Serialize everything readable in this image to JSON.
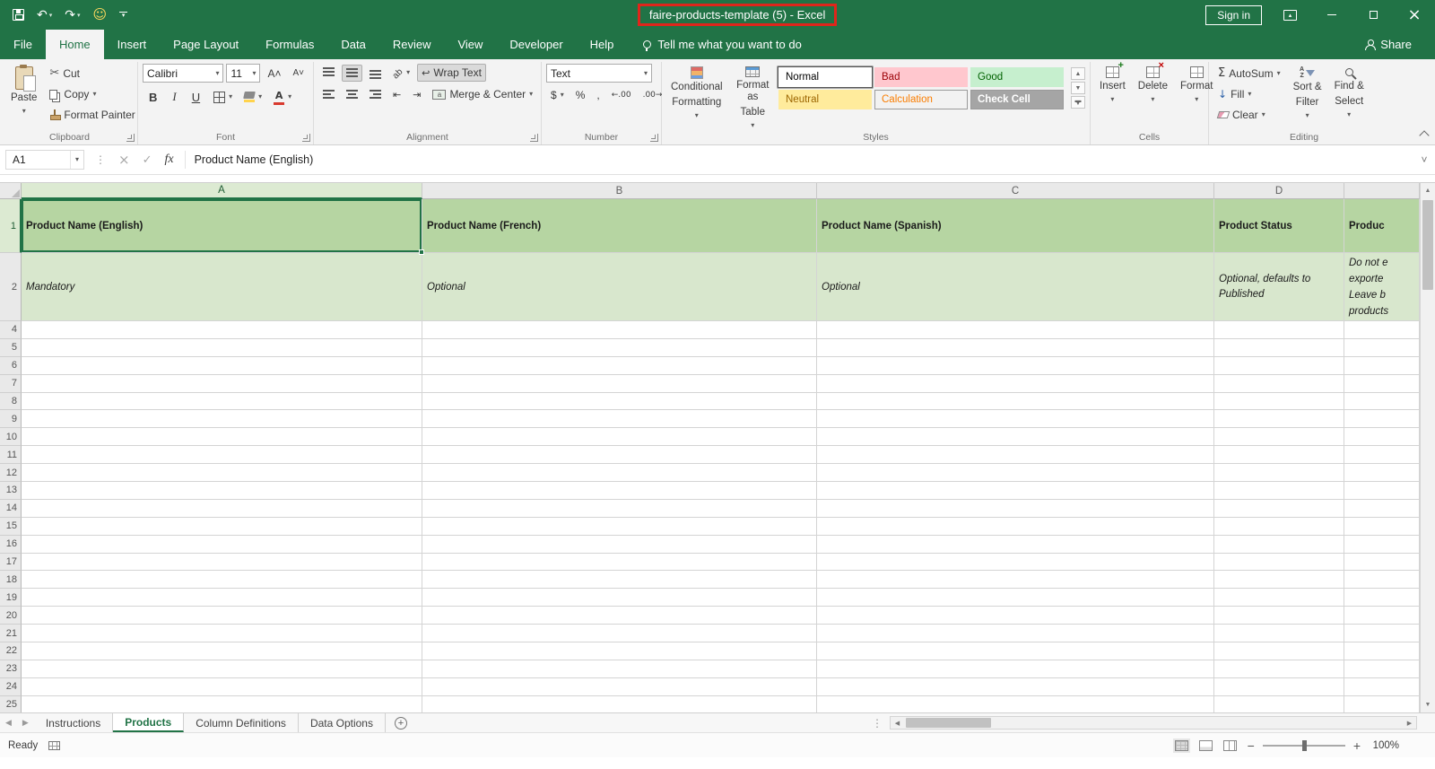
{
  "titlebar": {
    "title": "faire-products-template (5)  -  Excel",
    "sign_in_label": "Sign in"
  },
  "menu": {
    "tabs": [
      {
        "label": "File"
      },
      {
        "label": "Home"
      },
      {
        "label": "Insert"
      },
      {
        "label": "Page Layout"
      },
      {
        "label": "Formulas"
      },
      {
        "label": "Data"
      },
      {
        "label": "Review"
      },
      {
        "label": "View"
      },
      {
        "label": "Developer"
      },
      {
        "label": "Help"
      }
    ],
    "tell_me": "Tell me what you want to do",
    "share_label": "Share"
  },
  "ribbon": {
    "clipboard": {
      "group_label": "Clipboard",
      "paste_label": "Paste",
      "cut_label": "Cut",
      "copy_label": "Copy",
      "format_painter_label": "Format Painter"
    },
    "font": {
      "group_label": "Font",
      "font_name": "Calibri",
      "font_size": "11",
      "bold_label": "B",
      "italic_label": "I",
      "underline_label": "U"
    },
    "alignment": {
      "group_label": "Alignment",
      "wrap_text_label": "Wrap Text",
      "merge_center_label": "Merge & Center"
    },
    "number": {
      "group_label": "Number",
      "format_value": "Text",
      "currency_label": "$",
      "percent_label": "%",
      "comma_label": ","
    },
    "styles": {
      "group_label": "Styles",
      "conditional_line1": "Conditional",
      "conditional_line2": "Formatting",
      "format_table_line1": "Format as",
      "format_table_line2": "Table",
      "gallery": [
        {
          "label": "Normal",
          "bg": "#ffffff",
          "fg": "#000000",
          "selected": true
        },
        {
          "label": "Bad",
          "bg": "#ffc7ce",
          "fg": "#9c0006"
        },
        {
          "label": "Good",
          "bg": "#c6efce",
          "fg": "#006100"
        },
        {
          "label": "Neutral",
          "bg": "#ffeb9c",
          "fg": "#9c6500"
        },
        {
          "label": "Calculation",
          "bg": "#f2f2f2",
          "fg": "#fa7d00",
          "bordered": true
        },
        {
          "label": "Check Cell",
          "bg": "#a5a5a5",
          "fg": "#ffffff",
          "bordered": true,
          "bold": true
        }
      ]
    },
    "cells": {
      "group_label": "Cells",
      "insert_label": "Insert",
      "delete_label": "Delete",
      "format_label": "Format"
    },
    "editing": {
      "group_label": "Editing",
      "autosum_label": "AutoSum",
      "fill_label": "Fill",
      "clear_label": "Clear",
      "sort_line1": "Sort &",
      "sort_line2": "Filter",
      "find_line1": "Find &",
      "find_line2": "Select"
    }
  },
  "formula_bar": {
    "name_box": "A1",
    "fx_label": "fx",
    "content": "Product Name (English)"
  },
  "grid": {
    "columns": [
      {
        "label": "A"
      },
      {
        "label": "B"
      },
      {
        "label": "C"
      },
      {
        "label": "D"
      },
      {
        "label": ""
      }
    ],
    "row1": {
      "number": "1",
      "a": "Product Name (English)",
      "b": "Product Name (French)",
      "c": "Product Name (Spanish)",
      "d": "Product Status",
      "e": "Produc"
    },
    "row2": {
      "number": "2",
      "a": "Mandatory",
      "b": "Optional",
      "c": "Optional",
      "d": "Optional, defaults to Published",
      "e_lines": [
        "Do not e",
        "exporte",
        "Leave b",
        "products"
      ]
    },
    "empty_row_numbers": [
      4,
      5,
      6,
      7,
      8,
      9,
      10,
      11,
      12,
      13,
      14,
      15,
      16,
      17,
      18,
      19,
      20,
      21,
      22,
      23,
      24,
      25
    ]
  },
  "sheet_tabs": {
    "tabs": [
      {
        "label": "Instructions"
      },
      {
        "label": "Products",
        "active": true
      },
      {
        "label": "Column Definitions"
      },
      {
        "label": "Data Options"
      }
    ]
  },
  "status_bar": {
    "ready_label": "Ready",
    "zoom_value": "100%"
  },
  "colors": {
    "excel_green": "#217346",
    "annotation_red": "#e0251b",
    "header_row_fill": "#b6d5a2",
    "description_row_fill": "#d8e7cd"
  }
}
